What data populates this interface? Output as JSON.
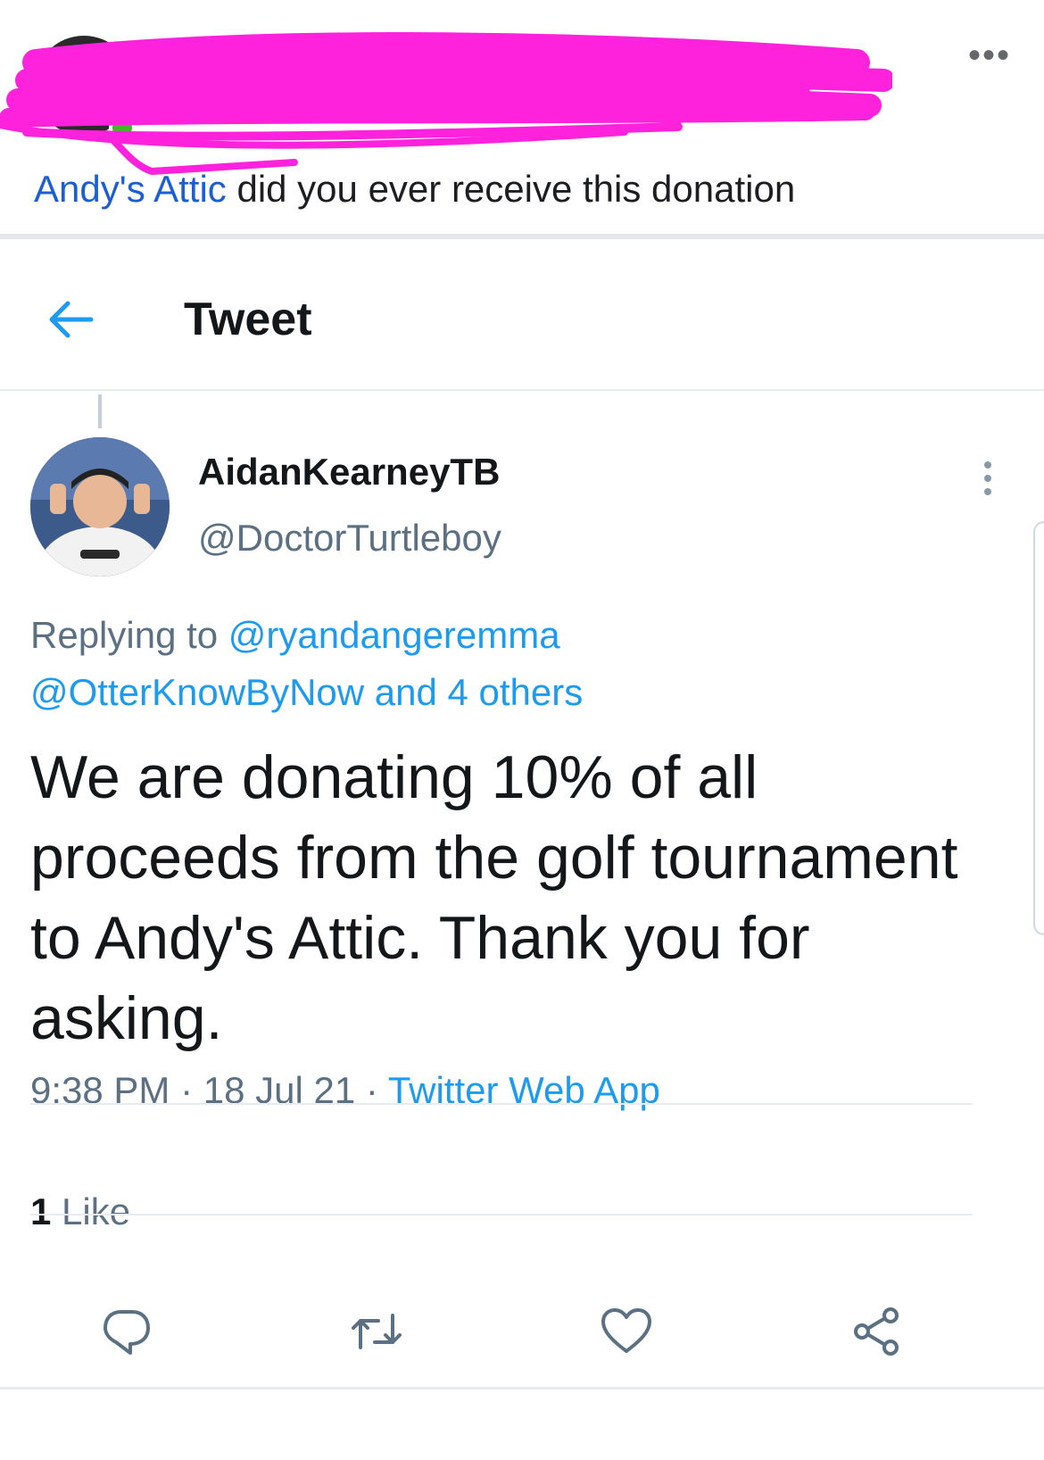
{
  "facebook_post": {
    "comment_mention": "Andy's Attic",
    "comment_text": " did you ever receive this donation",
    "more_icon": "ellipsis-icon",
    "redaction_color": "#ff22dd"
  },
  "tweet_header": {
    "title": "Tweet",
    "back_icon": "arrow-left-icon"
  },
  "tweet": {
    "display_name": "AidanKearneyTB",
    "handle": "@DoctorTurtleboy",
    "replying_prefix": "Replying to ",
    "reply_to_1": "@ryandangeremma",
    "reply_to_2": "@OtterKnowByNow",
    "reply_others": " and 4 others",
    "text": "We are donating 10% of all proceeds from the golf tournament to Andy's Attic. Thank you for asking.",
    "time": "9:38 PM",
    "separator": " · ",
    "date": "18 Jul 21",
    "source": "Twitter Web App",
    "like_count": "1",
    "like_label": " Like"
  },
  "actions": [
    "reply-icon",
    "retweet-icon",
    "like-icon",
    "share-icon"
  ],
  "colors": {
    "link_blue": "#1d9bf0",
    "mention_blue": "#1b5fd8",
    "muted_gray": "#5b7083"
  }
}
